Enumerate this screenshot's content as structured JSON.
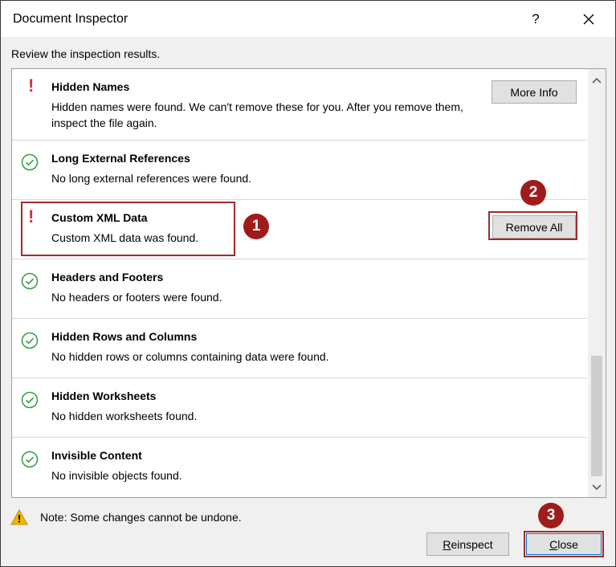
{
  "window": {
    "title": "Document Inspector",
    "help_label": "?"
  },
  "instruction": "Review the inspection results.",
  "results": [
    {
      "status": "found",
      "title": "Hidden Names",
      "description": "Hidden names were found. We can't remove these for you. After you remove them, inspect the file again.",
      "action_label": "More Info"
    },
    {
      "status": "clean",
      "title": "Long External References",
      "description": "No long external references were found."
    },
    {
      "status": "found",
      "title": "Custom XML Data",
      "description": "Custom XML data was found.",
      "action_label": "Remove All"
    },
    {
      "status": "clean",
      "title": "Headers and Footers",
      "description": "No headers or footers were found."
    },
    {
      "status": "clean",
      "title": "Hidden Rows and Columns",
      "description": "No hidden rows or columns containing data were found."
    },
    {
      "status": "clean",
      "title": "Hidden Worksheets",
      "description": "No hidden worksheets found."
    },
    {
      "status": "clean",
      "title": "Invisible Content",
      "description": "No invisible objects found."
    }
  ],
  "note": "Note: Some changes cannot be undone.",
  "footer": {
    "reinspect_label": "einspect",
    "reinspect_accel": "R",
    "close_label": "lose",
    "close_accel": "C"
  },
  "annotations": [
    "1",
    "2",
    "3"
  ],
  "colors": {
    "alert": "#d13438",
    "check": "#2e9e44",
    "annotation": "#a01c1c"
  }
}
